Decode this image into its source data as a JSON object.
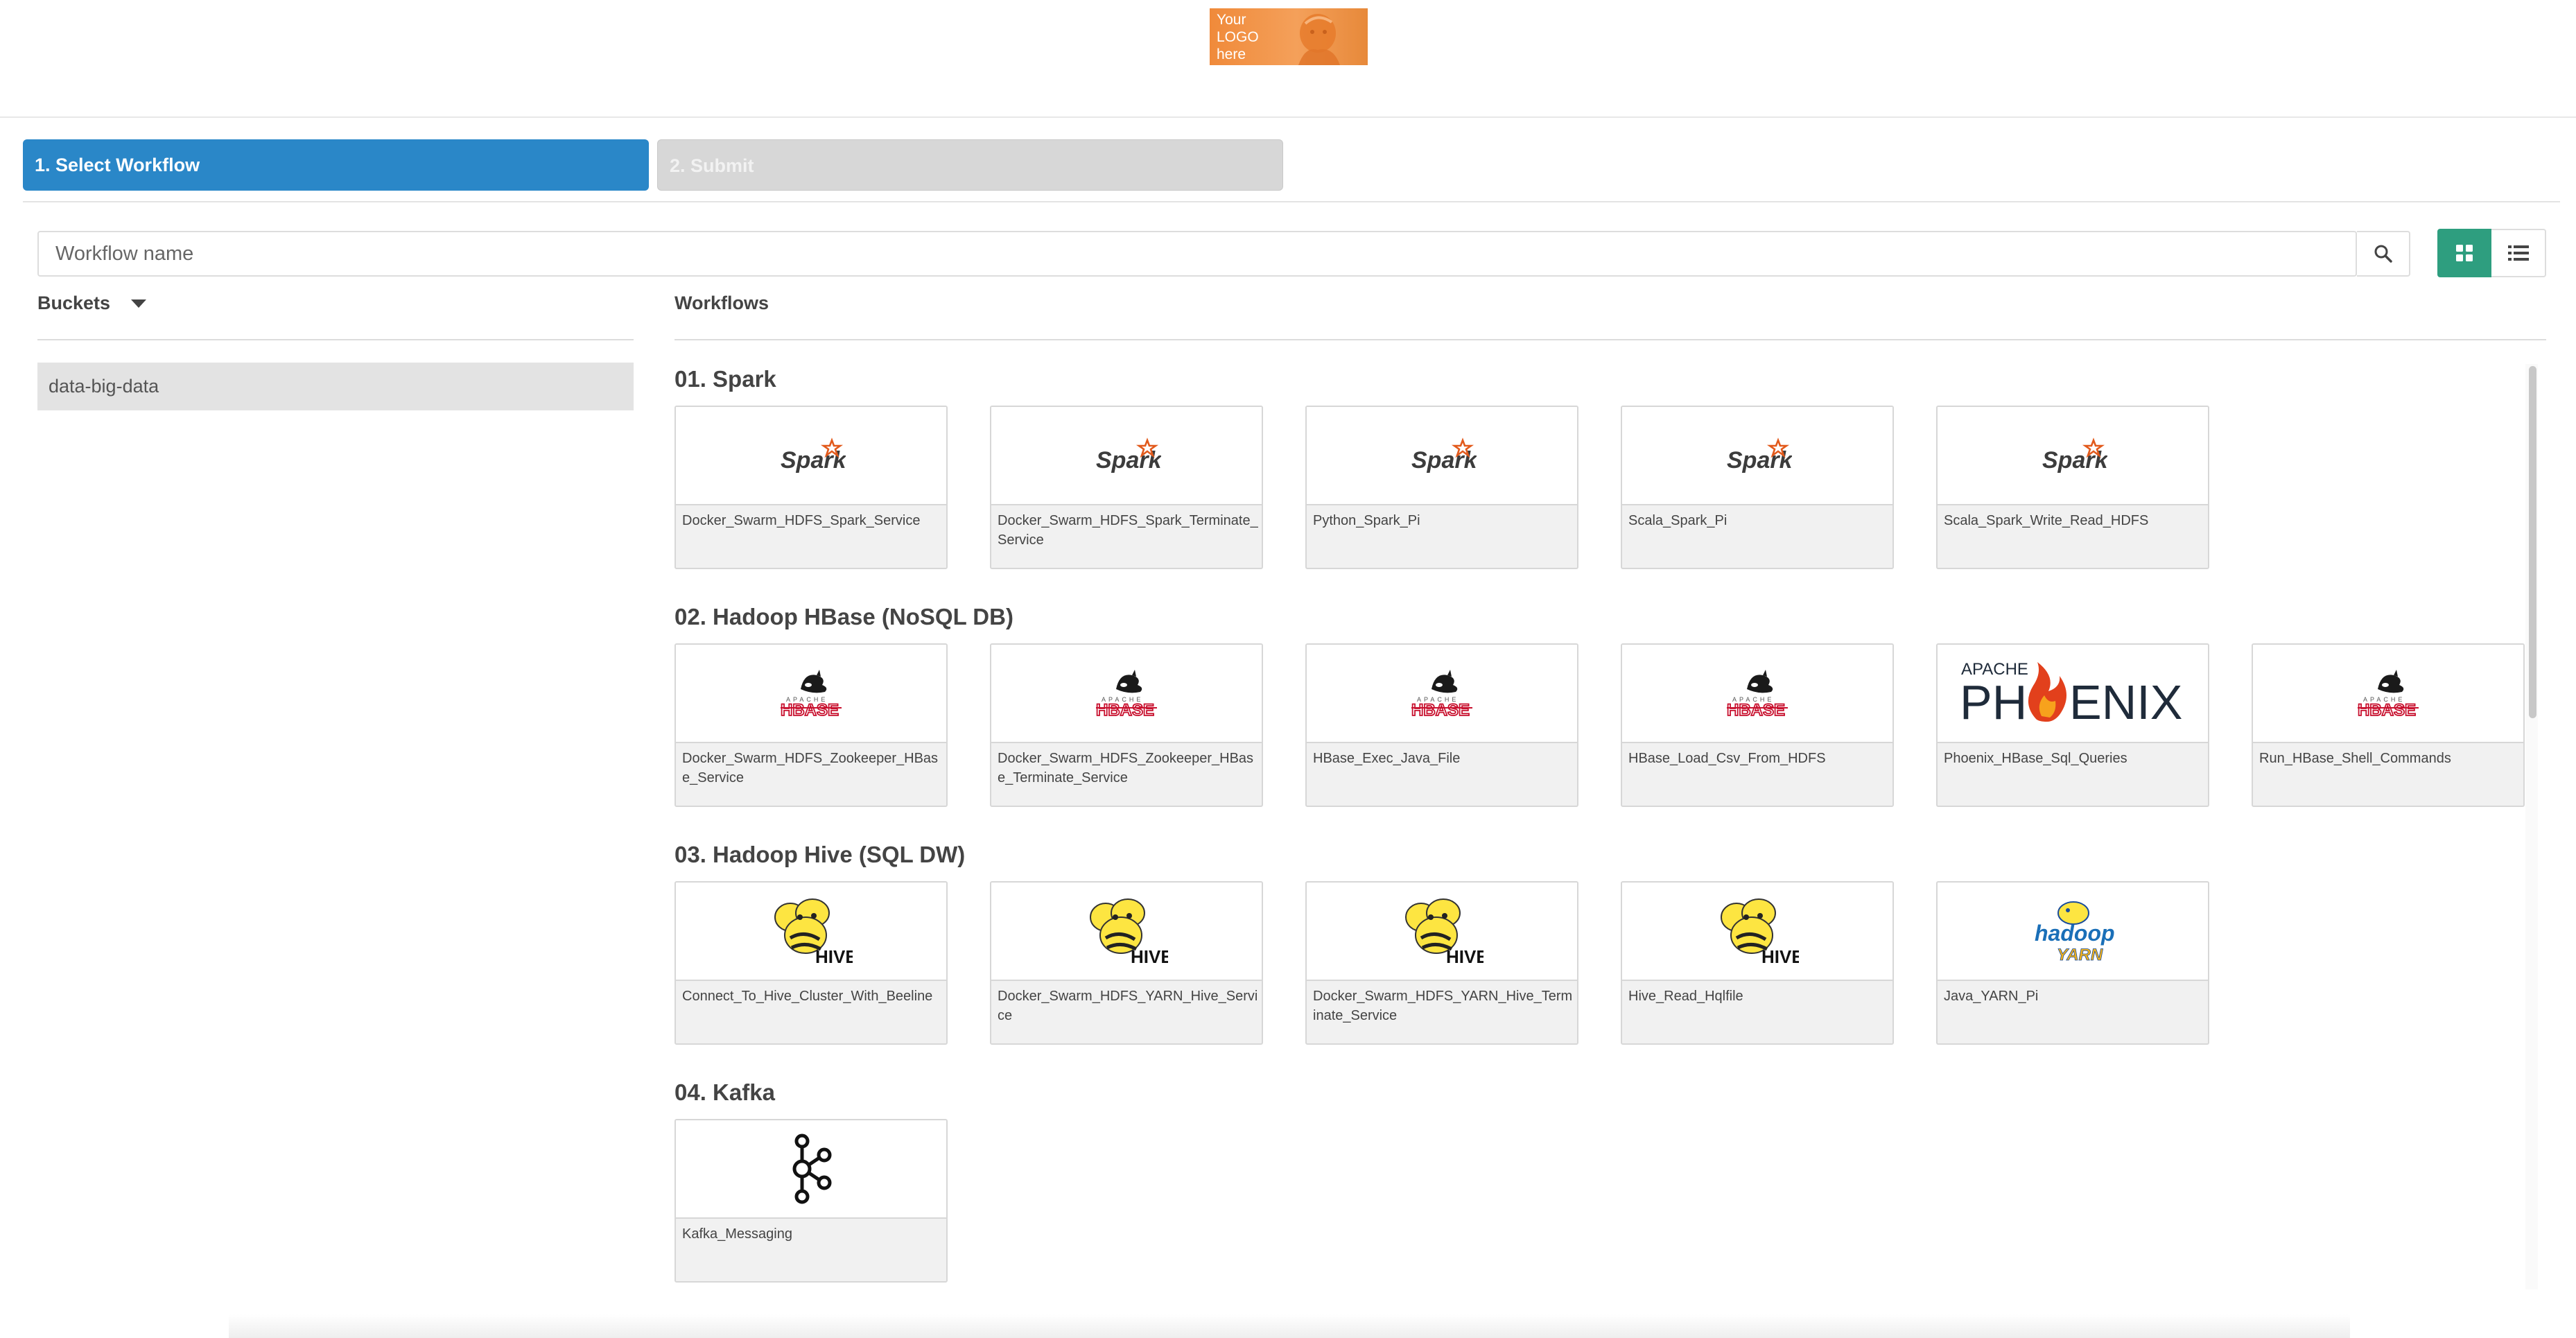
{
  "logo": {
    "text": "Your LOGO here"
  },
  "steps": [
    {
      "label": "1. Select Workflow",
      "state": "active"
    },
    {
      "label": "2. Submit",
      "state": "inactive"
    }
  ],
  "search": {
    "placeholder": "Workflow name",
    "value": "",
    "icon": "search-icon"
  },
  "view_toggle": {
    "grid_icon": "grid-view-icon",
    "list_icon": "list-view-icon",
    "active": "grid"
  },
  "colors": {
    "step_active": "#2a87c8",
    "grid_active": "#2e9e7f",
    "bucket_selected": "#e3e3e3"
  },
  "buckets": {
    "title": "Buckets",
    "caret_icon": "caret-down-icon",
    "items": [
      {
        "label": "data-big-data",
        "selected": true
      }
    ]
  },
  "workflows": {
    "title": "Workflows",
    "categories": [
      {
        "title": "01. Spark",
        "items": [
          {
            "label": "Docker_Swarm_HDFS_Spark_Service",
            "logo": "spark-logo-icon"
          },
          {
            "label": "Docker_Swarm_HDFS_Spark_Terminate_Service",
            "logo": "spark-logo-icon"
          },
          {
            "label": "Python_Spark_Pi",
            "logo": "spark-logo-icon"
          },
          {
            "label": "Scala_Spark_Pi",
            "logo": "spark-logo-icon"
          },
          {
            "label": "Scala_Spark_Write_Read_HDFS",
            "logo": "spark-logo-icon"
          }
        ]
      },
      {
        "title": "02. Hadoop HBase (NoSQL DB)",
        "items": [
          {
            "label": "Docker_Swarm_HDFS_Zookeeper_HBase_Service",
            "logo": "hbase-logo-icon"
          },
          {
            "label": "Docker_Swarm_HDFS_Zookeeper_HBase_Terminate_Service",
            "logo": "hbase-logo-icon"
          },
          {
            "label": "HBase_Exec_Java_File",
            "logo": "hbase-logo-icon"
          },
          {
            "label": "HBase_Load_Csv_From_HDFS",
            "logo": "hbase-logo-icon"
          },
          {
            "label": "Phoenix_HBase_Sql_Queries",
            "logo": "phoenix-logo-icon"
          },
          {
            "label": "Run_HBase_Shell_Commands",
            "logo": "hbase-logo-icon"
          }
        ]
      },
      {
        "title": "03. Hadoop Hive (SQL DW)",
        "items": [
          {
            "label": "Connect_To_Hive_Cluster_With_Beeline",
            "logo": "hive-logo-icon"
          },
          {
            "label": "Docker_Swarm_HDFS_YARN_Hive_Service",
            "logo": "hive-logo-icon"
          },
          {
            "label": "Docker_Swarm_HDFS_YARN_Hive_Terminate_Service",
            "logo": "hive-logo-icon"
          },
          {
            "label": "Hive_Read_Hqlfile",
            "logo": "hive-logo-icon"
          },
          {
            "label": "Java_YARN_Pi",
            "logo": "hadoop-yarn-logo-icon"
          }
        ]
      },
      {
        "title": "04. Kafka",
        "items": [
          {
            "label": "Kafka_Messaging",
            "logo": "kafka-logo-icon"
          }
        ]
      }
    ]
  }
}
